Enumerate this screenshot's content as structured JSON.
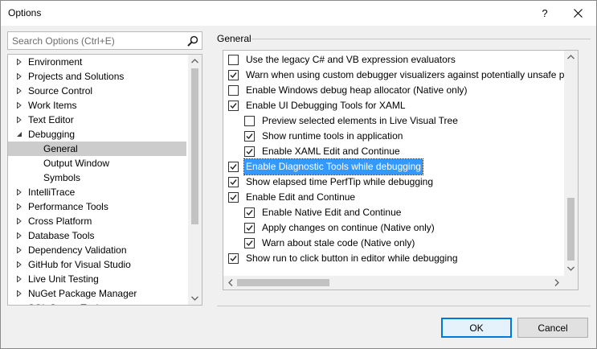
{
  "window": {
    "title": "Options",
    "help_glyph": "?"
  },
  "search": {
    "placeholder": "Search Options (Ctrl+E)",
    "value": ""
  },
  "tree": {
    "items": [
      {
        "label": "Environment",
        "level": 0,
        "expanded": false
      },
      {
        "label": "Projects and Solutions",
        "level": 0,
        "expanded": false
      },
      {
        "label": "Source Control",
        "level": 0,
        "expanded": false
      },
      {
        "label": "Work Items",
        "level": 0,
        "expanded": false
      },
      {
        "label": "Text Editor",
        "level": 0,
        "expanded": false
      },
      {
        "label": "Debugging",
        "level": 0,
        "expanded": true
      },
      {
        "label": "General",
        "level": 1,
        "selected": true
      },
      {
        "label": "Output Window",
        "level": 1
      },
      {
        "label": "Symbols",
        "level": 1
      },
      {
        "label": "IntelliTrace",
        "level": 0,
        "expanded": false
      },
      {
        "label": "Performance Tools",
        "level": 0,
        "expanded": false
      },
      {
        "label": "Cross Platform",
        "level": 0,
        "expanded": false
      },
      {
        "label": "Database Tools",
        "level": 0,
        "expanded": false
      },
      {
        "label": "Dependency Validation",
        "level": 0,
        "expanded": false
      },
      {
        "label": "GitHub for Visual Studio",
        "level": 0,
        "expanded": false
      },
      {
        "label": "Live Unit Testing",
        "level": 0,
        "expanded": false
      },
      {
        "label": "NuGet Package Manager",
        "level": 0,
        "expanded": false
      },
      {
        "label": "SQL Server Tools",
        "level": 0,
        "expanded": false
      }
    ]
  },
  "main": {
    "group_label": "General",
    "options": [
      {
        "label": "Use the legacy C# and VB expression evaluators",
        "checked": false,
        "level": 0
      },
      {
        "label": "Warn when using custom debugger visualizers against potentially unsafe processes (Managed only)",
        "checked": true,
        "level": 0
      },
      {
        "label": "Enable Windows debug heap allocator (Native only)",
        "checked": false,
        "level": 0
      },
      {
        "label": "Enable UI Debugging Tools for XAML",
        "checked": true,
        "level": 0
      },
      {
        "label": "Preview selected elements in Live Visual Tree",
        "checked": false,
        "level": 1
      },
      {
        "label": "Show runtime tools in application",
        "checked": true,
        "level": 1
      },
      {
        "label": "Enable XAML Edit and Continue",
        "checked": true,
        "level": 1
      },
      {
        "label": "Enable Diagnostic Tools while debugging",
        "checked": true,
        "level": 0,
        "highlight": true
      },
      {
        "label": "Show elapsed time PerfTip while debugging",
        "checked": true,
        "level": 0
      },
      {
        "label": "Enable Edit and Continue",
        "checked": true,
        "level": 0
      },
      {
        "label": "Enable Native Edit and Continue",
        "checked": true,
        "level": 1
      },
      {
        "label": "Apply changes on continue (Native only)",
        "checked": true,
        "level": 1
      },
      {
        "label": "Warn about stale code (Native only)",
        "checked": true,
        "level": 1
      },
      {
        "label": "Show run to click button in editor while debugging",
        "checked": true,
        "level": 0
      }
    ]
  },
  "buttons": {
    "ok": "OK",
    "cancel": "Cancel"
  },
  "icons": {
    "search": "search-icon",
    "close": "close-icon",
    "expand": "triangle-right-icon",
    "collapse": "triangle-down-icon"
  }
}
